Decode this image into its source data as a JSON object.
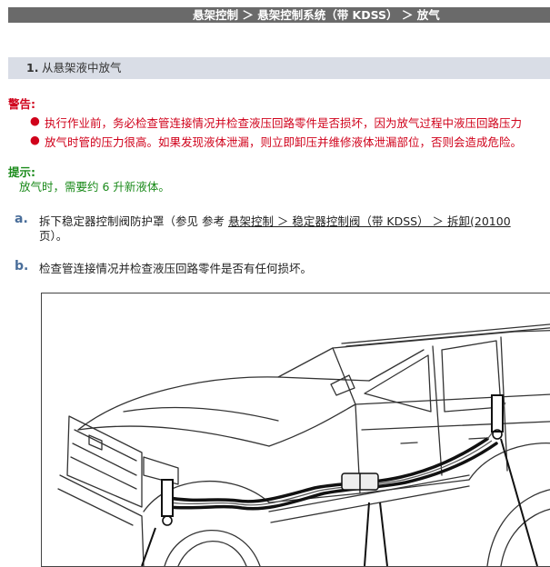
{
  "breadcrumb": "悬架控制 ＞ 悬架控制系统（带 KDSS） ＞ 放气",
  "section": {
    "number": "1.",
    "title": "从悬架液中放气"
  },
  "warning": {
    "title": "警告:",
    "items": [
      "执行作业前，务必检查管连接情况并检查液压回路零件是否损坏，因为放气过程中液压回路压力",
      "放气时管的压力很高。如果发现液体泄漏，则立即卸压并维修液体泄漏部位，否则会造成危险。"
    ]
  },
  "hint": {
    "title": "提示:",
    "text": "放气时，需要约 6 升新液体。"
  },
  "steps": [
    {
      "label": "a.",
      "prefix": "拆下稳定器控制阀防护罩（参见 参考 ",
      "link": "悬架控制 ＞ 稳定器控制阀（带 KDSS） ＞ 拆卸(20100",
      "line2": "页）。"
    },
    {
      "label": "b.",
      "text": "检查管连接情况并检查液压回路零件是否有任何损坏。"
    }
  ]
}
